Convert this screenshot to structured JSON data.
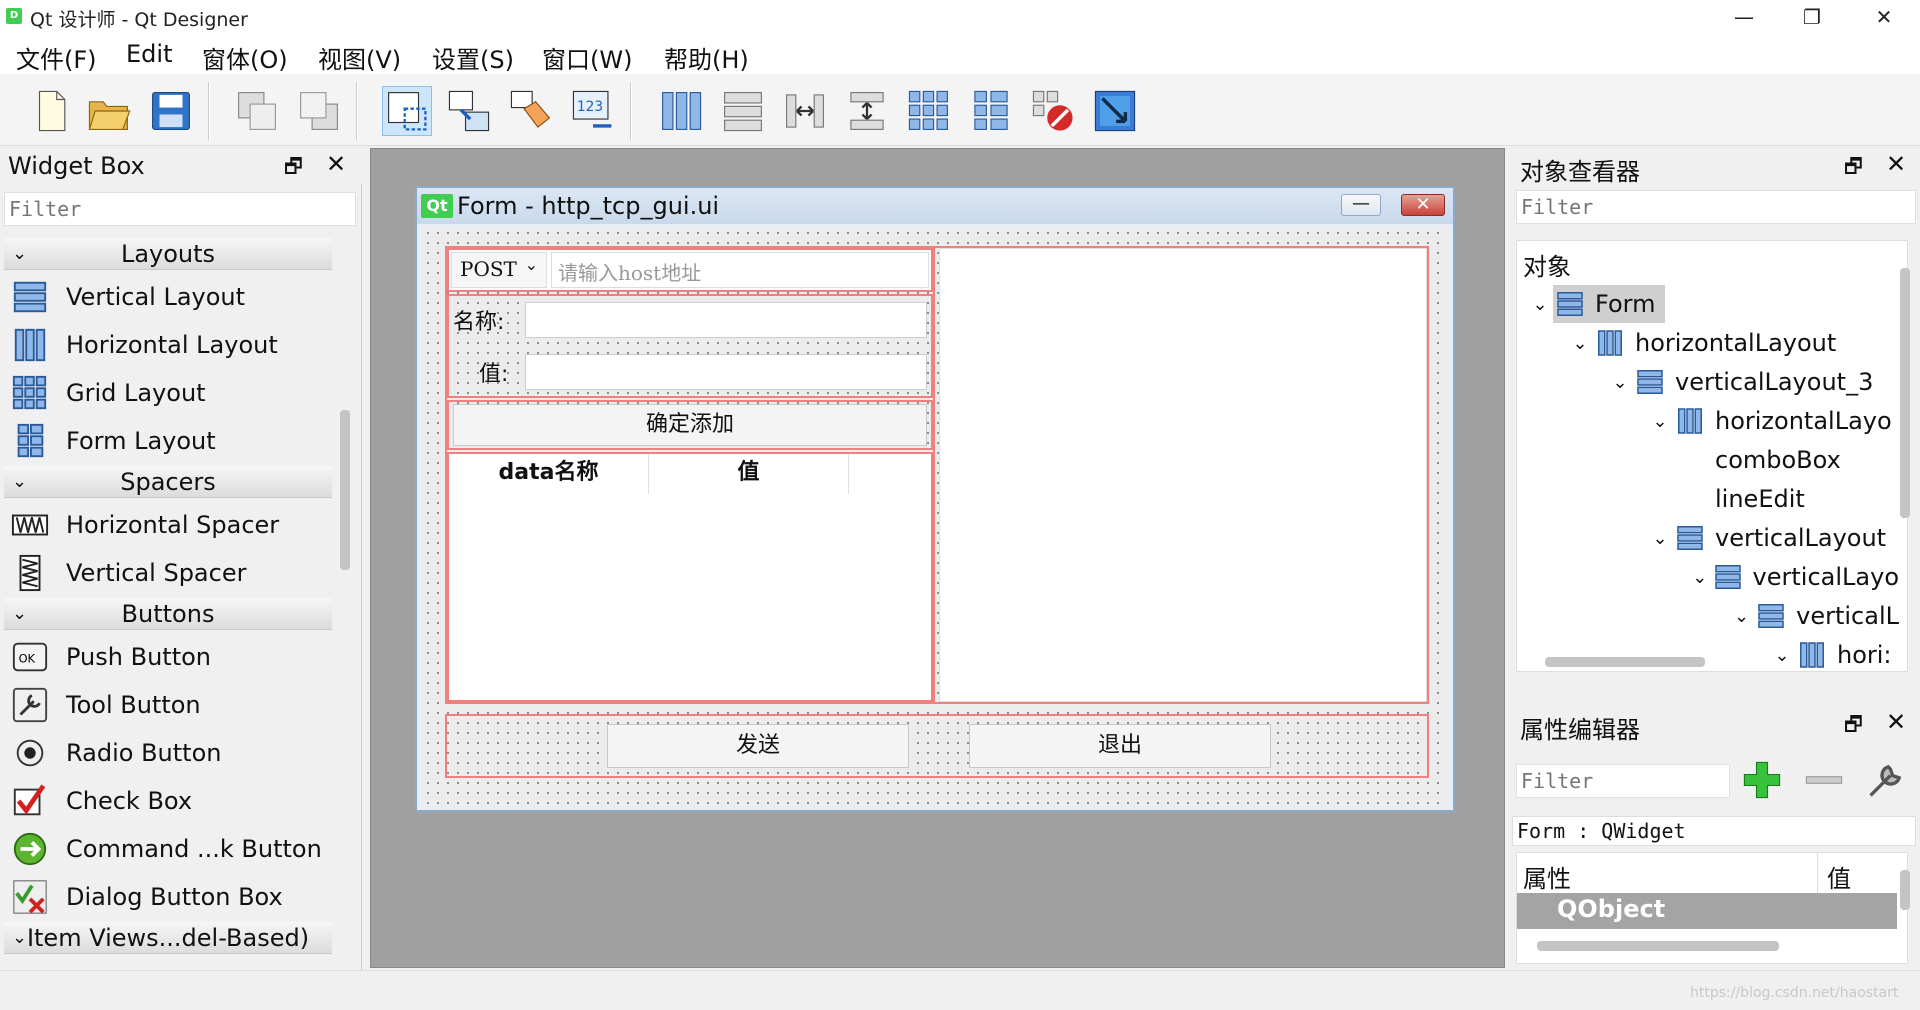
{
  "window": {
    "title": "Qt 设计师 - Qt Designer",
    "app_icon": "qt-designer-icon",
    "minimize": "—",
    "maximize": "❐",
    "close": "✕"
  },
  "menubar": [
    "文件(F)",
    "Edit",
    "窗体(O)",
    "视图(V)",
    "设置(S)",
    "窗口(W)",
    "帮助(H)"
  ],
  "toolbar": [
    "new-icon",
    "open-icon",
    "save-icon",
    "send-to-back-icon",
    "bring-to-front-icon",
    "edit-widgets-icon",
    "edit-signals-slots-icon",
    "edit-buddies-icon",
    "edit-tab-order-icon",
    "layout-horizontal-icon",
    "layout-vertical-icon",
    "layout-horizontal-splitter-icon",
    "layout-vertical-splitter-icon",
    "layout-grid-icon",
    "layout-form-icon",
    "break-layout-icon",
    "adjust-size-icon"
  ],
  "widget_box": {
    "title": "Widget Box",
    "filter_placeholder": "Filter",
    "categories": [
      {
        "label": "Layouts",
        "items": [
          "Vertical Layout",
          "Horizontal Layout",
          "Grid Layout",
          "Form Layout"
        ]
      },
      {
        "label": "Spacers",
        "items": [
          "Horizontal Spacer",
          "Vertical Spacer"
        ]
      },
      {
        "label": "Buttons",
        "items": [
          "Push Button",
          "Tool Button",
          "Radio Button",
          "Check Box",
          "Command ...k Button",
          "Dialog Button Box"
        ]
      },
      {
        "label": "Item Views...del-Based)",
        "items": []
      }
    ]
  },
  "form": {
    "title": "Form - http_tcp_gui.ui",
    "combo_value": "POST",
    "host_placeholder": "请输入host地址",
    "name_label": "名称:",
    "value_label": "值:",
    "add_button": "确定添加",
    "table_headers": [
      "data名称",
      "值"
    ],
    "send_button": "发送",
    "exit_button": "退出"
  },
  "object_inspector": {
    "title": "对象查看器",
    "filter_placeholder": "Filter",
    "header": "对象",
    "tree": [
      {
        "label": "Form",
        "chev": "⌄",
        "icon": "vertical-layout-icon",
        "selected": true
      },
      {
        "label": "horizontalLayout",
        "chev": "⌄",
        "icon": "horizontal-layout-icon"
      },
      {
        "label": "verticalLayout_3",
        "chev": "⌄",
        "icon": "vertical-layout-icon"
      },
      {
        "label": "horizontalLayo",
        "chev": "⌄",
        "icon": "horizontal-layout-icon"
      },
      {
        "label": "comboBox",
        "chev": "",
        "icon": ""
      },
      {
        "label": "lineEdit",
        "chev": "",
        "icon": ""
      },
      {
        "label": "verticalLayout",
        "chev": "⌄",
        "icon": "vertical-layout-icon"
      },
      {
        "label": "verticalLayo",
        "chev": "⌄",
        "icon": "vertical-layout-icon"
      },
      {
        "label": "verticalL",
        "chev": "⌄",
        "icon": "vertical-layout-icon"
      },
      {
        "label": "hori:",
        "chev": "⌄",
        "icon": "horizontal-layout-icon"
      }
    ]
  },
  "property_editor": {
    "title": "属性编辑器",
    "filter_placeholder": "Filter",
    "object_class": "Form : QWidget",
    "col_property": "属性",
    "col_value": "值",
    "section": "QObject"
  },
  "watermark": "https://blog.csdn.net/haostart"
}
